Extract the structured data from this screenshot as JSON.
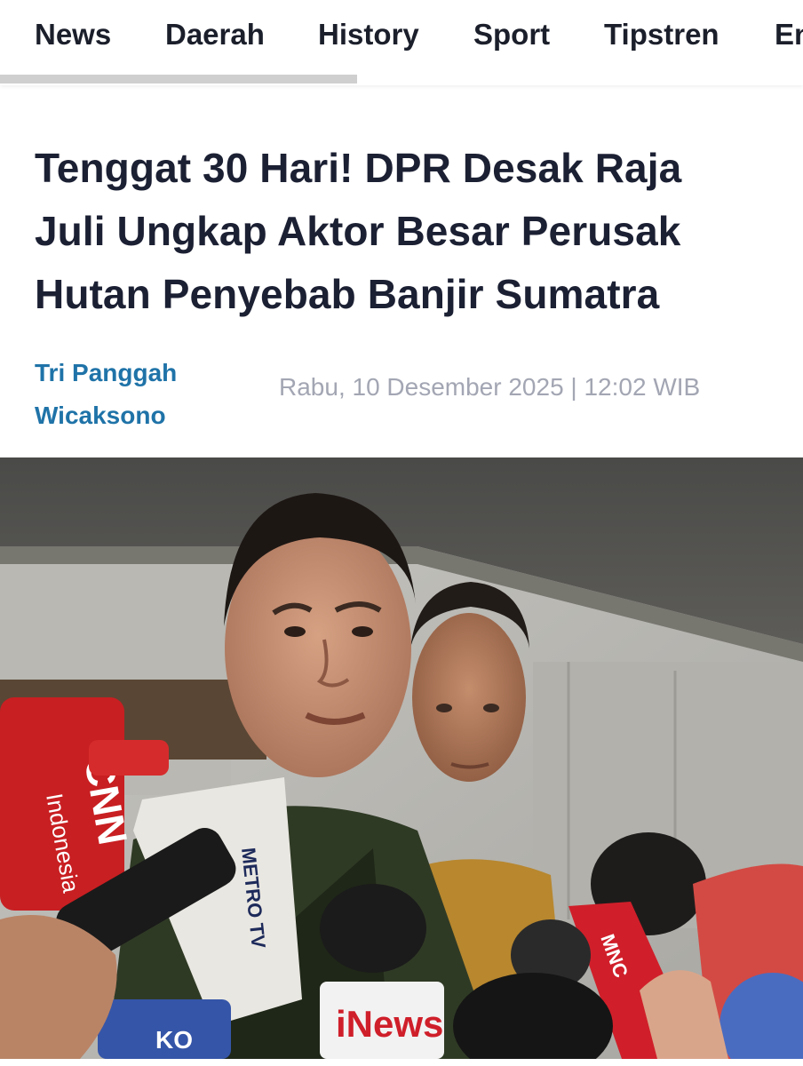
{
  "nav": {
    "items": [
      {
        "label": "News"
      },
      {
        "label": "Daerah"
      },
      {
        "label": "History"
      },
      {
        "label": "Sport"
      },
      {
        "label": "Tipstren"
      },
      {
        "label": "En"
      }
    ]
  },
  "article": {
    "title": "Tenggat 30 Hari! DPR Desak Raja Juli Ungkap Aktor Besar Perusak Hutan Penyebab Banjir Sumatra",
    "author": "Tri Panggah Wicaksono",
    "date": "Rabu, 10 Desember 2025 | 12:02 WIB"
  },
  "photo": {
    "mic_labels": {
      "cnn": "CNN",
      "cnn_sub": "Indonesia",
      "metro": "METRO TV",
      "inews": "iNews",
      "kompas": "KO",
      "red_mic": "MNC"
    }
  },
  "colors": {
    "nav_text": "#1b1f2b",
    "title_text": "#1c2033",
    "author_link": "#1f73a8",
    "date_text": "#a3a6b3"
  }
}
